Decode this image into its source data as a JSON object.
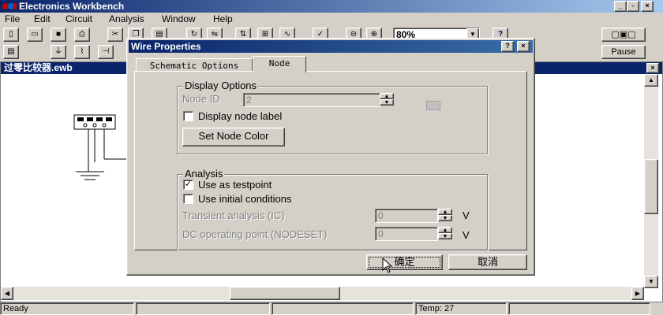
{
  "app": {
    "title": "Electronics Workbench",
    "caption_buttons": [
      "_",
      "▫",
      "×"
    ],
    "menu": [
      "File",
      "Edit",
      "Circuit",
      "Analysis",
      "Window",
      "Help"
    ],
    "zoom": "80%",
    "help_button": "?",
    "pause_label": "Pause"
  },
  "document": {
    "title": "过零比较器.ewb",
    "close_label": "×"
  },
  "status": {
    "ready": "Ready",
    "temp": "Temp:  27"
  },
  "dialog": {
    "title": "Wire Properties",
    "help_label": "?",
    "close_label": "×",
    "tabs": [
      "Schematic Options",
      "Node"
    ],
    "active_tab": "Node",
    "display_options": {
      "legend": "Display Options",
      "node_id_label": "Node ID",
      "node_id_value": "2",
      "display_node_label": "Display node label",
      "display_node_label_checked": false,
      "set_node_color": "Set Node Color"
    },
    "analysis": {
      "legend": "Analysis",
      "use_as_testpoint": "Use as testpoint",
      "use_as_testpoint_checked": true,
      "use_initial_conditions": "Use initial conditions",
      "use_initial_conditions_checked": false,
      "transient_label": "Transient analysis (IC)",
      "transient_value": "0",
      "transient_unit": "V",
      "dc_label": "DC operating point (NODESET)",
      "dc_value": "0",
      "dc_unit": "V"
    },
    "ok_label": "确定",
    "cancel_label": "取消"
  }
}
